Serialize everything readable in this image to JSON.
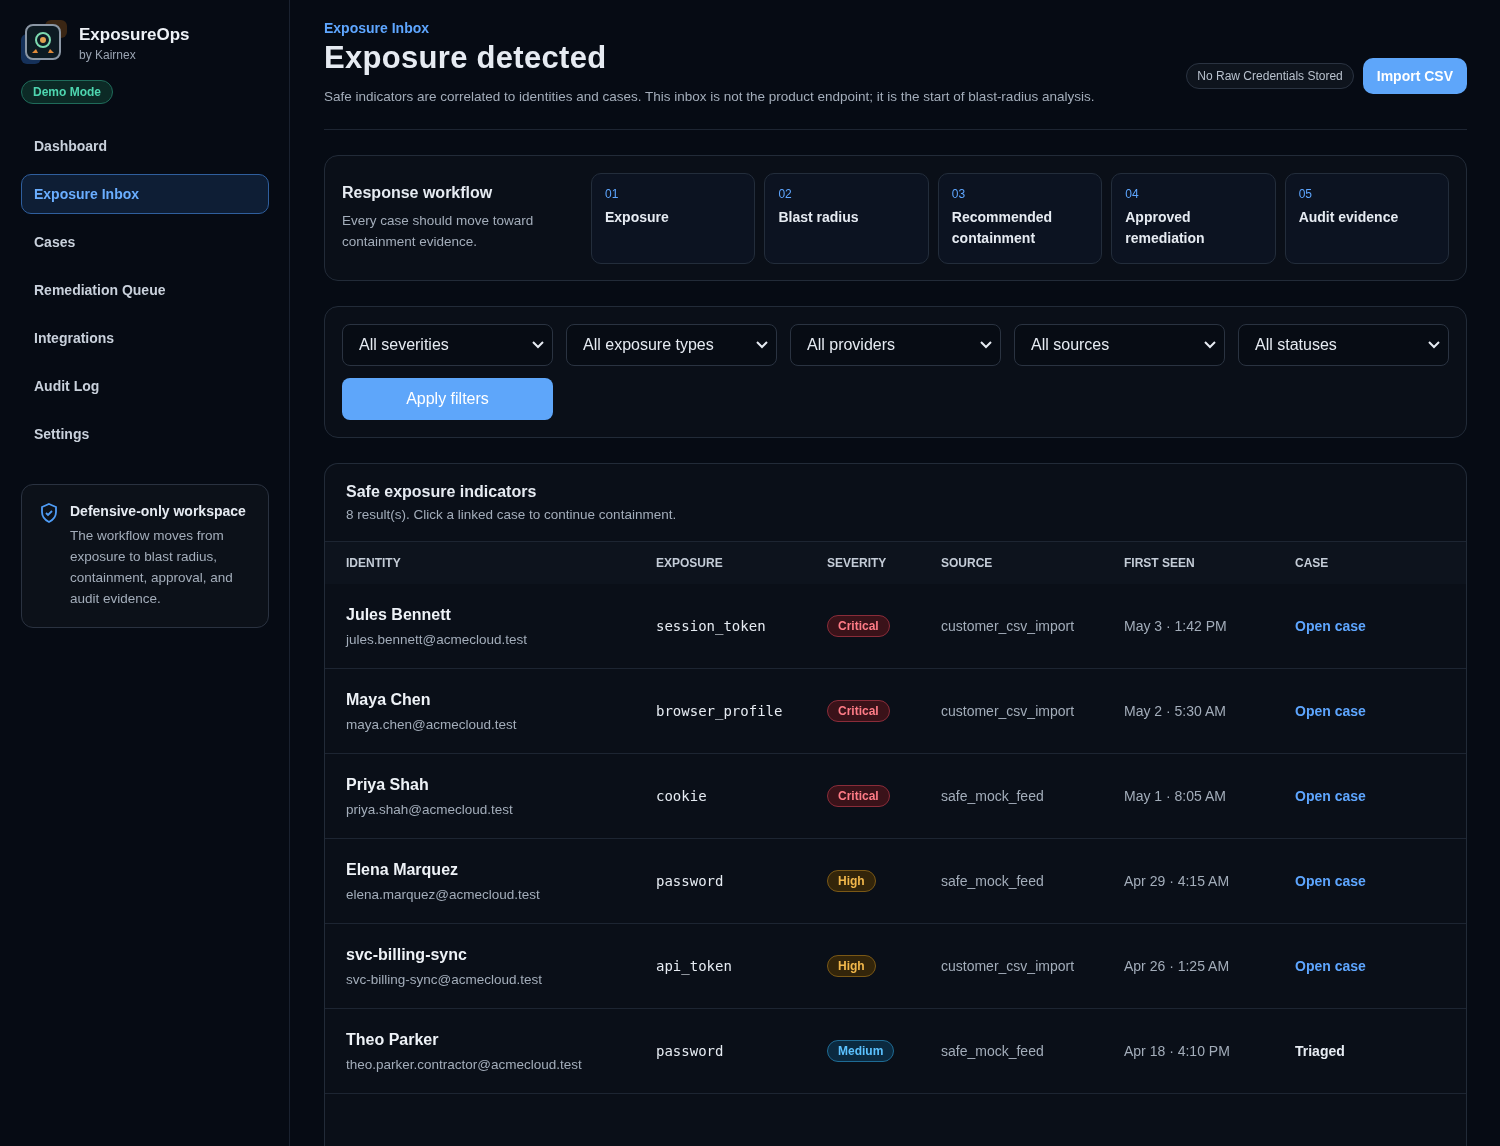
{
  "brand": {
    "name": "ExposureOps",
    "byline": "by Kairnex",
    "mode_badge": "Demo Mode"
  },
  "nav": [
    {
      "label": "Dashboard",
      "selected": false
    },
    {
      "label": "Exposure Inbox",
      "selected": true
    },
    {
      "label": "Cases",
      "selected": false
    },
    {
      "label": "Remediation Queue",
      "selected": false
    },
    {
      "label": "Integrations",
      "selected": false
    },
    {
      "label": "Audit Log",
      "selected": false
    },
    {
      "label": "Settings",
      "selected": false
    }
  ],
  "notice": {
    "title": "Defensive-only workspace",
    "body": "The workflow moves from exposure to blast radius, containment, approval, and audit evidence."
  },
  "header": {
    "breadcrumb": "Exposure Inbox",
    "title": "Exposure detected",
    "description": "Safe indicators are correlated to identities and cases. This inbox is not the product endpoint; it is the start of blast-radius analysis.",
    "badge": "No Raw Credentials Stored",
    "button": "Import CSV"
  },
  "workflow": {
    "title": "Response workflow",
    "subtitle": "Every case should move toward containment evidence.",
    "steps": [
      {
        "number": "01",
        "label": "Exposure"
      },
      {
        "number": "02",
        "label": "Blast radius"
      },
      {
        "number": "03",
        "label": "Recommended containment"
      },
      {
        "number": "04",
        "label": "Approved remediation"
      },
      {
        "number": "05",
        "label": "Audit evidence"
      }
    ]
  },
  "filters": {
    "selects": [
      "All severities",
      "All exposure types",
      "All providers",
      "All sources",
      "All statuses"
    ],
    "apply": "Apply filters"
  },
  "table": {
    "title": "Safe exposure indicators",
    "summary": "8 result(s). Click a linked case to continue containment.",
    "columns": [
      "IDENTITY",
      "EXPOSURE",
      "SEVERITY",
      "SOURCE",
      "FIRST SEEN",
      "CASE"
    ],
    "rows": [
      {
        "name": "Jules Bennett",
        "email": "jules.bennett@acmecloud.test",
        "exposure": "session_token",
        "severity": {
          "label": "Critical",
          "kind": "critical"
        },
        "source": "customer_csv_import",
        "first_seen": "May 3 · 1:42 PM",
        "case": {
          "label": "Open case",
          "kind": "link"
        }
      },
      {
        "name": "Maya Chen",
        "email": "maya.chen@acmecloud.test",
        "exposure": "browser_profile",
        "severity": {
          "label": "Critical",
          "kind": "critical"
        },
        "source": "customer_csv_import",
        "first_seen": "May 2 · 5:30 AM",
        "case": {
          "label": "Open case",
          "kind": "link"
        }
      },
      {
        "name": "Priya Shah",
        "email": "priya.shah@acmecloud.test",
        "exposure": "cookie",
        "severity": {
          "label": "Critical",
          "kind": "critical"
        },
        "source": "safe_mock_feed",
        "first_seen": "May 1 · 8:05 AM",
        "case": {
          "label": "Open case",
          "kind": "link"
        }
      },
      {
        "name": "Elena Marquez",
        "email": "elena.marquez@acmecloud.test",
        "exposure": "password",
        "severity": {
          "label": "High",
          "kind": "high"
        },
        "source": "safe_mock_feed",
        "first_seen": "Apr 29 · 4:15 AM",
        "case": {
          "label": "Open case",
          "kind": "link"
        }
      },
      {
        "name": "svc-billing-sync",
        "email": "svc-billing-sync@acmecloud.test",
        "exposure": "api_token",
        "severity": {
          "label": "High",
          "kind": "high"
        },
        "source": "customer_csv_import",
        "first_seen": "Apr 26 · 1:25 AM",
        "case": {
          "label": "Open case",
          "kind": "link"
        }
      },
      {
        "name": "Theo Parker",
        "email": "theo.parker.contractor@acmecloud.test",
        "exposure": "password",
        "severity": {
          "label": "Medium",
          "kind": "medium"
        },
        "source": "safe_mock_feed",
        "first_seen": "Apr 18 · 4:10 PM",
        "case": {
          "label": "Triaged",
          "kind": "status"
        }
      }
    ]
  }
}
